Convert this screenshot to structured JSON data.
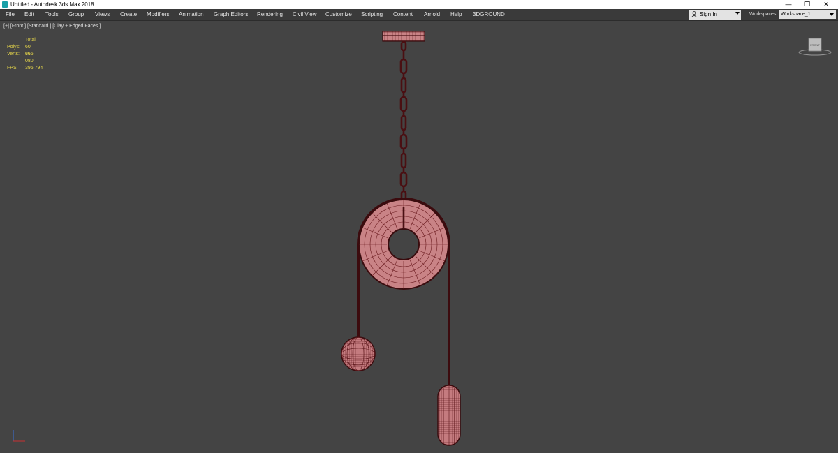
{
  "app": {
    "title": "Untitled - Autodesk 3ds Max 2018",
    "window_controls": {
      "minimize": "—",
      "restore": "❐",
      "close": "✕"
    }
  },
  "menu": {
    "items": [
      "File",
      "Edit",
      "Tools",
      "Group",
      "Views",
      "Create",
      "Modifiers",
      "Animation",
      "Graph Editors",
      "Rendering",
      "Civil View",
      "Customize",
      "Scripting",
      "Content",
      "Arnold",
      "Help",
      "3DGROUND"
    ]
  },
  "account": {
    "sign_in": "Sign In"
  },
  "workspace": {
    "label": "Workspaces:",
    "value": "Workspace_1"
  },
  "viewport": {
    "label": "[+] [Front ] [Standard ] [Clay + Edged Faces ]",
    "stats": {
      "header": "Total",
      "polys_label": "Polys:",
      "polys_value": "60 666",
      "verts_label": "Verts:",
      "verts_value": "35 080",
      "fps_label": "FPS:",
      "fps_value": "396,794"
    },
    "viewcube_label": "FRONT"
  },
  "colors": {
    "viewport_bg": "#444444",
    "mesh_fill": "#c98386",
    "mesh_wire": "#5a1418",
    "stats_text": "#e6d64a"
  }
}
